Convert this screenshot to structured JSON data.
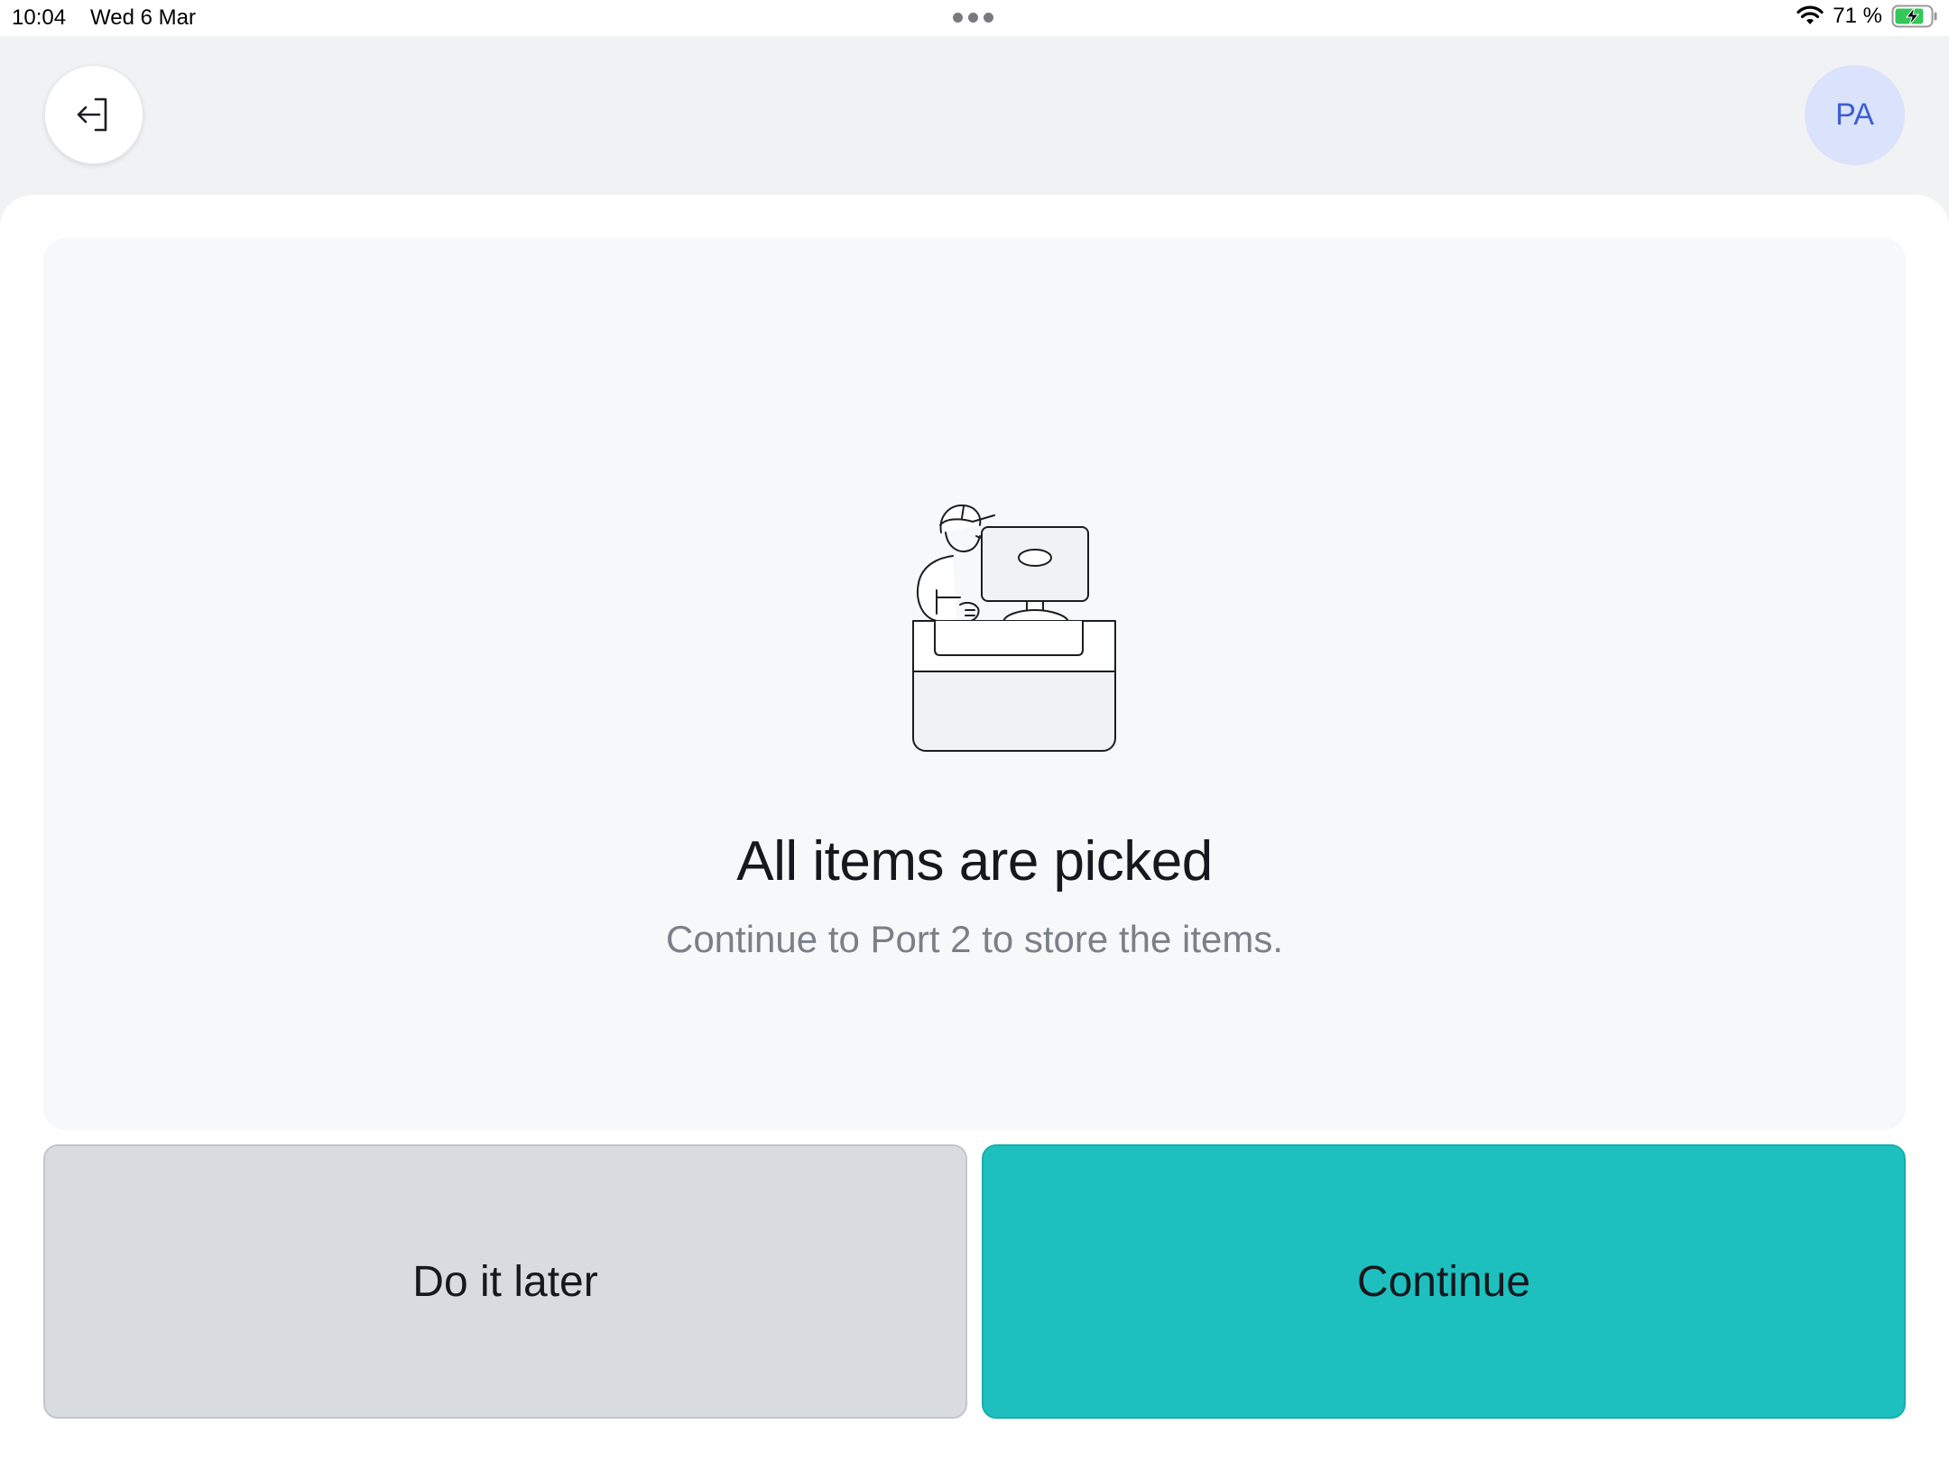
{
  "status_bar": {
    "time": "10:04",
    "date": "Wed 6 Mar",
    "battery_percent": "71 %",
    "battery_level": 0.71,
    "wifi_icon": "wifi-icon",
    "battery_icon": "battery-charging-icon"
  },
  "header": {
    "exit_icon": "exit-arrow-icon",
    "avatar_initials": "PA"
  },
  "main": {
    "illustration": "worker-at-computer-illustration",
    "title": "All items are picked",
    "subtitle": "Continue to Port 2 to store the items."
  },
  "actions": {
    "later_label": "Do it later",
    "continue_label": "Continue"
  },
  "colors": {
    "accent": "#1ec0bf",
    "secondary_button": "#d8dbe0",
    "avatar_bg": "#dbe2fb",
    "avatar_text": "#3a5fd0"
  }
}
